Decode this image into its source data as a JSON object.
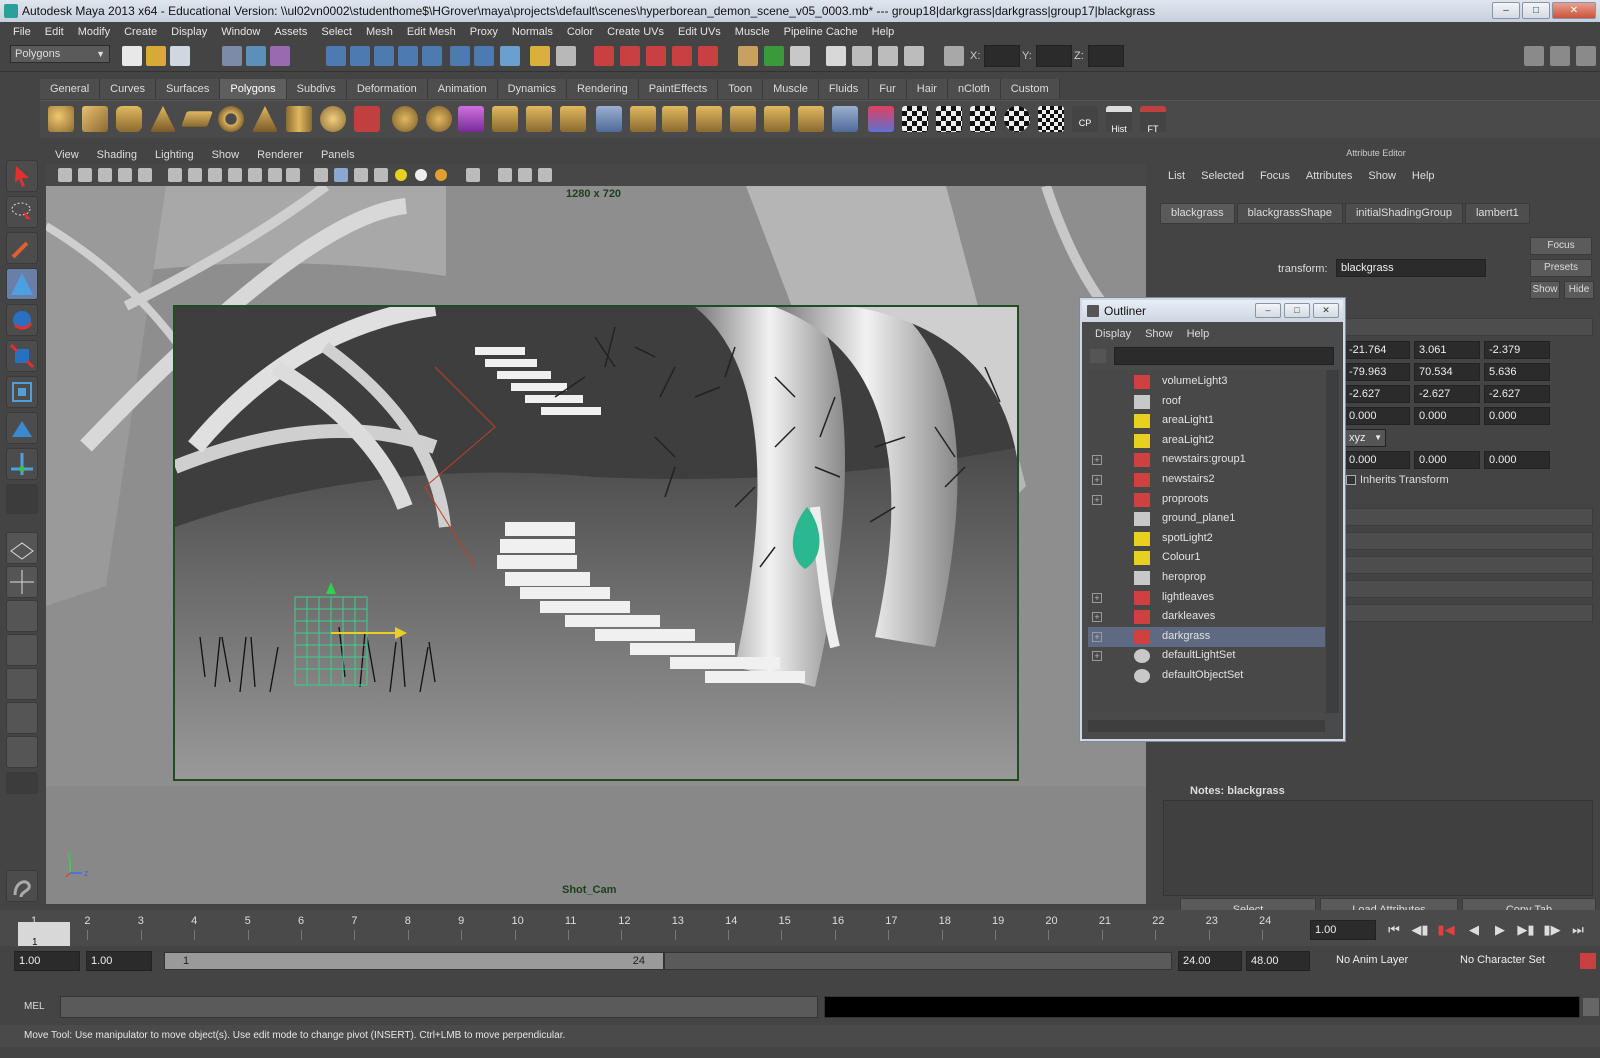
{
  "window": {
    "title": "Autodesk Maya 2013 x64 - Educational Version: \\\\ul02vn0002\\studenthome$\\HGrover\\maya\\projects\\default\\scenes\\hyperborean_demon_scene_v05_0003.mb*   ---   group18|darkgrass|darkgrass|group17|blackgrass"
  },
  "menubar": [
    "File",
    "Edit",
    "Modify",
    "Create",
    "Display",
    "Window",
    "Assets",
    "Select",
    "Mesh",
    "Edit Mesh",
    "Proxy",
    "Normals",
    "Color",
    "Create UVs",
    "Edit UVs",
    "Muscle",
    "Pipeline Cache",
    "Help"
  ],
  "statusline": {
    "mode": "Polygons",
    "x_label": "X:",
    "y_label": "Y:",
    "z_label": "Z:"
  },
  "shelf": {
    "tabs": [
      "General",
      "Curves",
      "Surfaces",
      "Polygons",
      "Subdivs",
      "Deformation",
      "Animation",
      "Dynamics",
      "Rendering",
      "PaintEffects",
      "Toon",
      "Muscle",
      "Fluids",
      "Fur",
      "Hair",
      "nCloth",
      "Custom"
    ],
    "active": "Polygons",
    "icon_labels": [
      "CP",
      "Hist",
      "FT"
    ]
  },
  "viewport": {
    "menu": [
      "View",
      "Shading",
      "Lighting",
      "Show",
      "Renderer",
      "Panels"
    ],
    "resolution": "1280 x 720",
    "camera": "Shot_Cam",
    "axis_y": "y",
    "axis_x": "x",
    "axis_z": "z"
  },
  "attribute_editor": {
    "title": "Attribute Editor",
    "menu": [
      "List",
      "Selected",
      "Focus",
      "Attributes",
      "Show",
      "Help"
    ],
    "tabs": [
      "blackgrass",
      "blackgrassShape",
      "initialShadingGroup",
      "lambert1"
    ],
    "transform_label": "transform:",
    "transform_value": "blackgrass",
    "buttons": {
      "focus": "Focus",
      "presets": "Presets",
      "show": "Show",
      "hide": "Hide"
    },
    "rows": [
      [
        "-21.764",
        "3.061",
        "-2.379"
      ],
      [
        "-79.963",
        "70.534",
        "5.636"
      ],
      [
        "-2.627",
        "-2.627",
        "-2.627"
      ],
      [
        "0.000",
        "0.000",
        "0.000"
      ]
    ],
    "rotate_order": "xyz",
    "row5": [
      "0.000",
      "0.000",
      "0.000"
    ],
    "inherits": "Inherits Transform",
    "notes_label": "Notes: blackgrass",
    "bottom_buttons": [
      "Select",
      "Load Attributes",
      "Copy Tab"
    ]
  },
  "outliner": {
    "title": "Outliner",
    "menu": [
      "Display",
      "Show",
      "Help"
    ],
    "items": [
      {
        "label": "volumeLight3",
        "icon": "transform-icon",
        "expand": false,
        "selected": false
      },
      {
        "label": "roof",
        "icon": "mesh-icon",
        "expand": false,
        "selected": false
      },
      {
        "label": "areaLight1",
        "icon": "area-light-icon",
        "expand": false,
        "selected": false
      },
      {
        "label": "areaLight2",
        "icon": "area-light-icon",
        "expand": false,
        "selected": false
      },
      {
        "label": "newstairs:group1",
        "icon": "transform-icon",
        "expand": true,
        "selected": false
      },
      {
        "label": "newstairs2",
        "icon": "transform-icon",
        "expand": true,
        "selected": false
      },
      {
        "label": "proproots",
        "icon": "transform-icon",
        "expand": true,
        "selected": false
      },
      {
        "label": "ground_plane1",
        "icon": "mesh-icon",
        "expand": false,
        "selected": false
      },
      {
        "label": "spotLight2",
        "icon": "spot-light-icon",
        "expand": false,
        "selected": false
      },
      {
        "label": "Colour1",
        "icon": "point-light-icon",
        "expand": false,
        "selected": false
      },
      {
        "label": "heroprop",
        "icon": "mesh-icon",
        "expand": false,
        "selected": false
      },
      {
        "label": "lightleaves",
        "icon": "transform-icon",
        "expand": true,
        "selected": false
      },
      {
        "label": "darkleaves",
        "icon": "transform-icon",
        "expand": true,
        "selected": false
      },
      {
        "label": "darkgrass",
        "icon": "transform-icon",
        "expand": true,
        "selected": true
      },
      {
        "label": "defaultLightSet",
        "icon": "set-icon",
        "expand": true,
        "selected": false
      },
      {
        "label": "defaultObjectSet",
        "icon": "set-icon",
        "expand": false,
        "selected": false
      }
    ]
  },
  "timeline": {
    "ticks": [
      "1",
      "2",
      "3",
      "4",
      "5",
      "6",
      "7",
      "8",
      "9",
      "10",
      "11",
      "12",
      "13",
      "14",
      "15",
      "16",
      "17",
      "18",
      "19",
      "20",
      "21",
      "22",
      "23",
      "24"
    ],
    "current_frame_label": "1",
    "current_time": "1.00"
  },
  "range": {
    "start": "1.00",
    "start2": "1.00",
    "slider_start": "1",
    "slider_end": "24",
    "end": "24.00",
    "end2": "48.00",
    "anim_layer": "No Anim Layer",
    "character_set": "No Character Set"
  },
  "mel": {
    "label": "MEL"
  },
  "helpline": "Move Tool: Use manipulator to move object(s). Use edit mode to change pivot (INSERT).  Ctrl+LMB to move perpendicular."
}
